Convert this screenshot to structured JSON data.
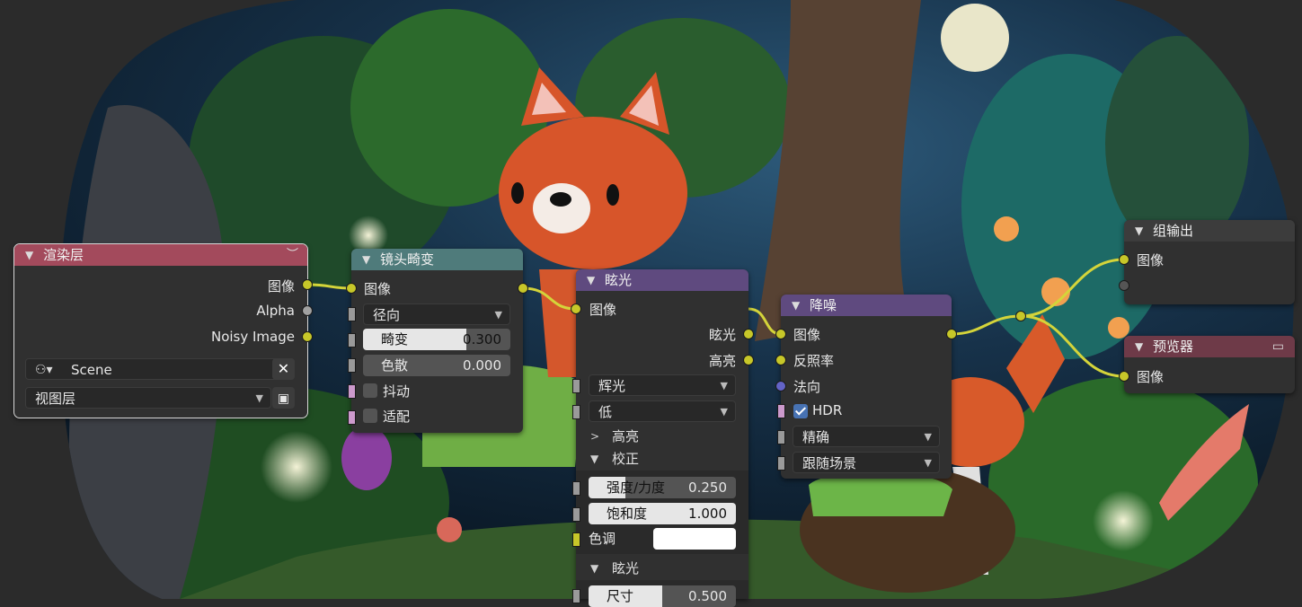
{
  "render_layers": {
    "title": "渲染层",
    "outputs": [
      "图像",
      "Alpha",
      "Noisy Image"
    ],
    "scene_value": "Scene",
    "layer_value": "视图层"
  },
  "lens_distortion": {
    "title": "镜头畸变",
    "input": "图像",
    "projector_value": "径向",
    "distort": {
      "label": "畸变",
      "value": "0.300",
      "fraction": 0.7
    },
    "dispersion": {
      "label": "色散",
      "value": "0.000",
      "fraction": 0
    },
    "jitter_label": "抖动",
    "fit_label": "适配"
  },
  "glare": {
    "title": "眩光",
    "input": "图像",
    "outputs": [
      "眩光",
      "高亮"
    ],
    "type_value": "辉光",
    "quality_value": "低",
    "highlights_section": "高亮",
    "adjust_section": "校正",
    "strength": {
      "label": "强度/力度",
      "value": "0.250",
      "fraction": 0.25
    },
    "saturation": {
      "label": "饱和度",
      "value": "1.000",
      "fraction": 1.0
    },
    "tint_label": "色调",
    "glare_section": "眩光",
    "size": {
      "label": "尺寸",
      "value": "0.500",
      "fraction": 0.5
    }
  },
  "denoise": {
    "title": "降噪",
    "inputs": [
      "图像",
      "反照率",
      "法向"
    ],
    "hdr_label": "HDR",
    "hdr_checked": true,
    "prefilter_value": "精确",
    "quality_value": "跟随场景"
  },
  "group_output": {
    "title": "组输出",
    "input": "图像"
  },
  "viewer": {
    "title": "预览器",
    "input": "图像",
    "icon": "monitor-icon"
  },
  "colors": {
    "input_header": "#a34a5c",
    "distort_header": "#4f7b7b",
    "filter_header": "#5f4a7f",
    "output_header": "#3c3c3c",
    "viewer_header": "#6e3a48",
    "color_socket": "#c7c729",
    "value_socket": "#a1a1a1",
    "vector_socket": "#6363c7",
    "link": "#d4d43a"
  }
}
